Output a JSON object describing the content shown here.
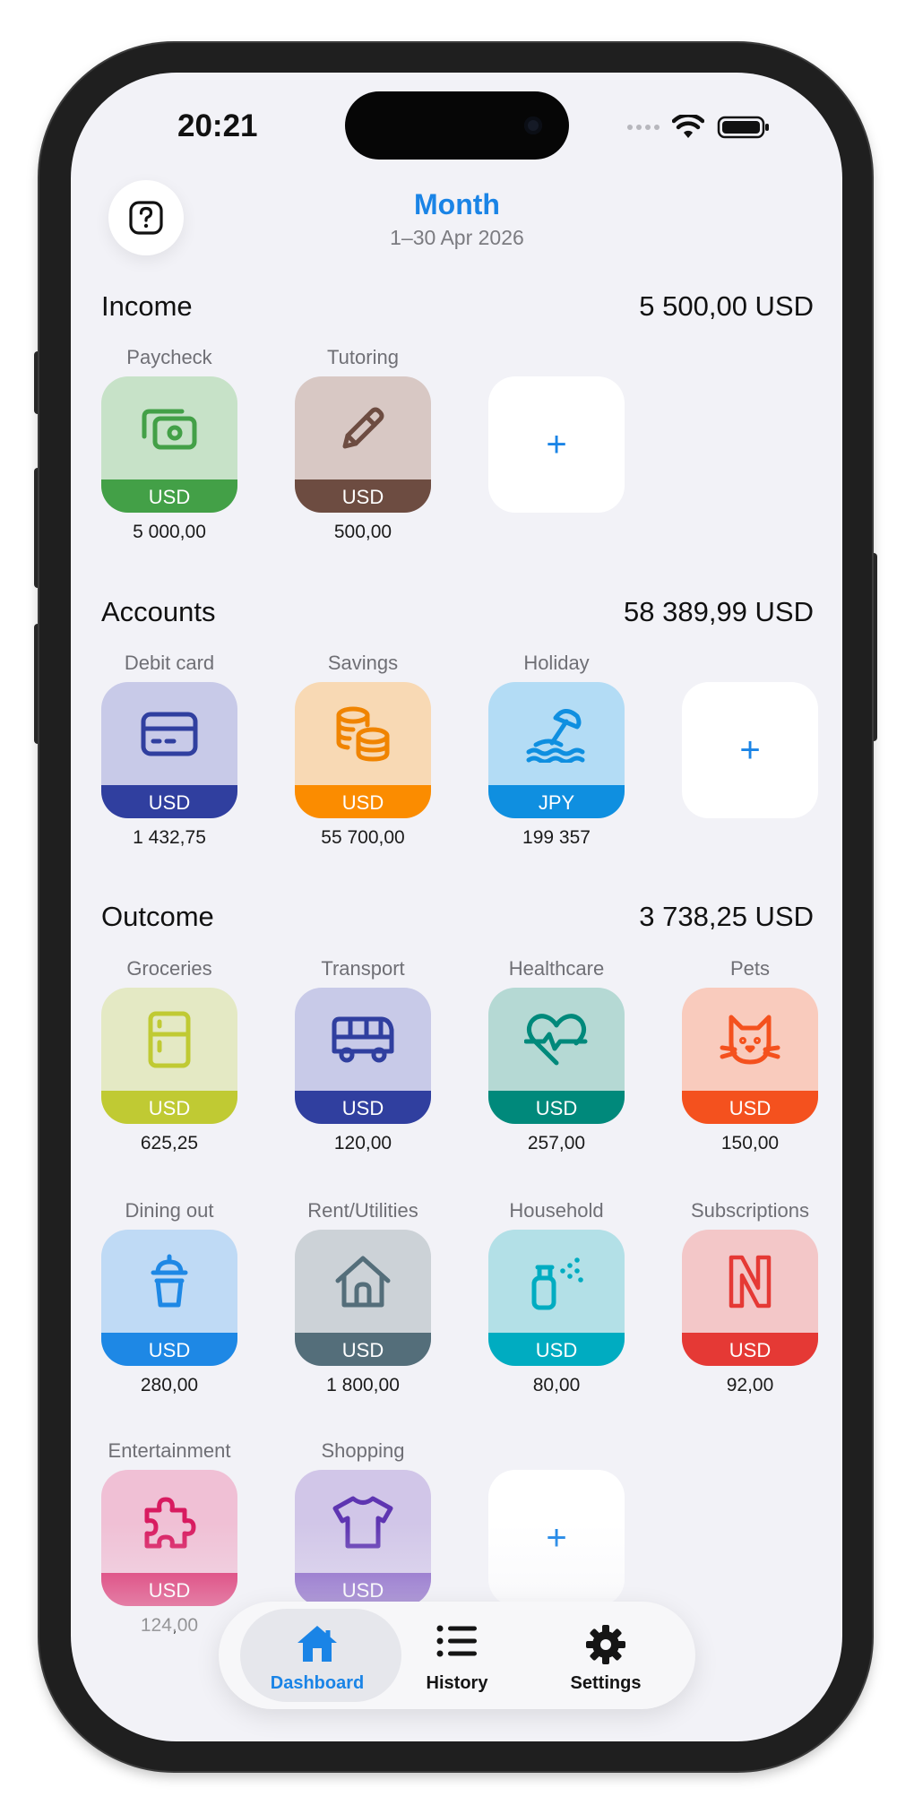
{
  "status_bar": {
    "time": "20:21"
  },
  "header": {
    "period_title": "Month",
    "period_range": "1–30 Apr 2026"
  },
  "colors": {
    "accent": "#1a84e6",
    "background": "#f2f2f7"
  },
  "income": {
    "title": "Income",
    "total": "5 500,00 USD",
    "items": [
      {
        "label": "Paycheck",
        "currency": "USD",
        "amount": "5 000,00",
        "icon": "cash-icon",
        "bg": "#c7e2c8",
        "band": "#43a047",
        "fg": "#43a047"
      },
      {
        "label": "Tutoring",
        "currency": "USD",
        "amount": "500,00",
        "icon": "pencil-icon",
        "bg": "#d8c8c4",
        "band": "#6d4c41",
        "fg": "#6d4c41"
      }
    ],
    "add_label": "+"
  },
  "accounts": {
    "title": "Accounts",
    "total": "58 389,99 USD",
    "items": [
      {
        "label": "Debit card",
        "currency": "USD",
        "amount": "1 432,75",
        "icon": "credit-card-icon",
        "bg": "#c8cae8",
        "band": "#303f9f",
        "fg": "#303f9f"
      },
      {
        "label": "Savings",
        "currency": "USD",
        "amount": "55 700,00",
        "icon": "coins-icon",
        "bg": "#f8d9b4",
        "band": "#fb8c00",
        "fg": "#f08400"
      },
      {
        "label": "Holiday",
        "currency": "JPY",
        "amount": "199 357",
        "icon": "beach-umbrella-icon",
        "bg": "#b3dcf5",
        "band": "#0f8fe0",
        "fg": "#0f8fe0"
      }
    ],
    "add_label": "+"
  },
  "outcome": {
    "title": "Outcome",
    "total": "3 738,25 USD",
    "items": [
      {
        "label": "Groceries",
        "currency": "USD",
        "amount": "625,25",
        "icon": "fridge-icon",
        "bg": "#e4e9c4",
        "band": "#c0ca33",
        "fg": "#c0ca33"
      },
      {
        "label": "Transport",
        "currency": "USD",
        "amount": "120,00",
        "icon": "bus-icon",
        "bg": "#c8cae8",
        "band": "#303f9f",
        "fg": "#303f9f"
      },
      {
        "label": "Healthcare",
        "currency": "USD",
        "amount": "257,00",
        "icon": "heart-pulse-icon",
        "bg": "#b5d9d4",
        "band": "#00897b",
        "fg": "#00897b"
      },
      {
        "label": "Pets",
        "currency": "USD",
        "amount": "150,00",
        "icon": "cat-icon",
        "bg": "#f9cbbd",
        "band": "#f4511e",
        "fg": "#f4511e"
      },
      {
        "label": "Dining out",
        "currency": "USD",
        "amount": "280,00",
        "icon": "drink-cup-icon",
        "bg": "#bfdaf5",
        "band": "#1e88e5",
        "fg": "#1e88e5"
      },
      {
        "label": "Rent/Utilities",
        "currency": "USD",
        "amount": "1 800,00",
        "icon": "house-icon",
        "bg": "#ccd2d7",
        "band": "#546e7a",
        "fg": "#546e7a"
      },
      {
        "label": "Household",
        "currency": "USD",
        "amount": "80,00",
        "icon": "spray-bottle-icon",
        "bg": "#b3e0e7",
        "band": "#00acc1",
        "fg": "#00acc1"
      },
      {
        "label": "Subscriptions",
        "currency": "USD",
        "amount": "92,00",
        "icon": "netflix-n-icon",
        "bg": "#f3c7c8",
        "band": "#e53935",
        "fg": "#e53935"
      },
      {
        "label": "Entertainment",
        "currency": "USD",
        "amount": "124,00",
        "icon": "puzzle-icon",
        "bg": "#f0c0d5",
        "band": "#d81b60",
        "fg": "#d81b60"
      },
      {
        "label": "Shopping",
        "currency": "USD",
        "amount": "",
        "icon": "tshirt-icon",
        "bg": "#d1c6e8",
        "band": "#7e57c2",
        "fg": "#5e35b1"
      }
    ],
    "add_label": "+"
  },
  "tabbar": {
    "tabs": [
      {
        "label": "Dashboard",
        "icon": "house-fill-icon",
        "active": true
      },
      {
        "label": "History",
        "icon": "list-icon",
        "active": false
      },
      {
        "label": "Settings",
        "icon": "gear-icon",
        "active": false
      }
    ]
  }
}
